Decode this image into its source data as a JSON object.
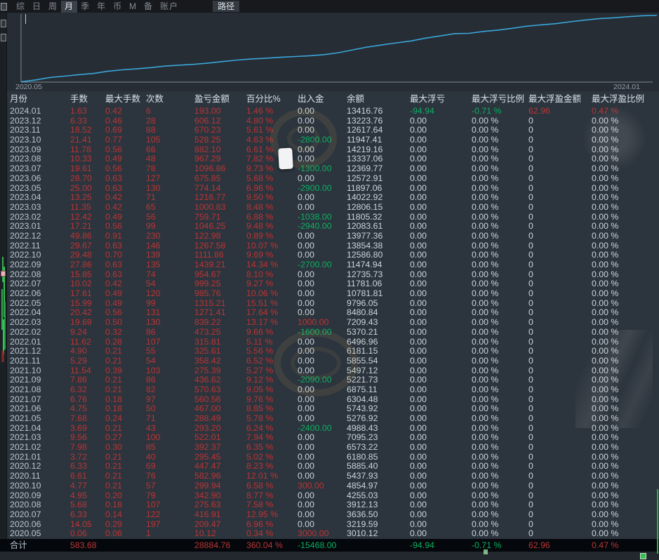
{
  "menu": {
    "items": [
      {
        "label": "综",
        "active": false
      },
      {
        "label": "日",
        "active": false
      },
      {
        "label": "周",
        "active": false
      },
      {
        "label": "月",
        "active": true
      },
      {
        "label": "季",
        "active": false
      },
      {
        "label": "年",
        "active": false
      },
      {
        "label": "币",
        "active": false
      },
      {
        "label": "M",
        "active": false
      },
      {
        "label": "备",
        "active": false
      },
      {
        "label": "账户",
        "active": false
      }
    ],
    "path_label": "路径"
  },
  "chart": {
    "x_start_label": "2020.05",
    "x_end_label": "2024.01"
  },
  "chart_data": {
    "type": "line",
    "x": [
      "2020.05",
      "2020.06",
      "2020.07",
      "2020.08",
      "2020.09",
      "2020.10",
      "2020.11",
      "2020.12",
      "2021.01",
      "2021.02",
      "2021.03",
      "2021.04",
      "2021.05",
      "2021.06",
      "2021.07",
      "2021.08",
      "2021.09",
      "2021.10",
      "2021.11",
      "2021.12",
      "2022.01",
      "2022.02",
      "2022.03",
      "2022.04",
      "2022.05",
      "2022.06",
      "2022.07",
      "2022.08",
      "2022.09",
      "2022.10",
      "2022.11",
      "2022.12",
      "2023.01",
      "2023.02",
      "2023.03",
      "2023.04",
      "2023.05",
      "2023.06",
      "2023.07",
      "2023.08",
      "2023.09",
      "2023.10",
      "2023.11",
      "2023.12",
      "2024.01"
    ],
    "series": [
      {
        "name": "cumulative-profit",
        "values": [
          10.12,
          219.59,
          636.5,
          912.13,
          1255.03,
          1554.97,
          2137.93,
          2585.4,
          2880.85,
          3273.22,
          3795.23,
          4088.43,
          4376.92,
          4843.92,
          5404.48,
          5975.11,
          6411.73,
          6687.12,
          7045.54,
          7371.15,
          7686.96,
          8160.21,
          8999.43,
          10270.84,
          11586.05,
          12571.81,
          13571.06,
          14525.73,
          15964.94,
          17076.8,
          18344.38,
          18467.36,
          19513.61,
          20273.32,
          21274.15,
          22490.92,
          23265.06,
          23940.91,
          25037.77,
          26005.06,
          26887.16,
          27415.41,
          28085.64,
          28691.76,
          28884.76
        ]
      }
    ],
    "monthly_profit": [
      10.12,
      209.47,
      416.91,
      275.63,
      342.9,
      299.94,
      582.96,
      447.47,
      295.45,
      392.37,
      522.01,
      293.2,
      288.49,
      467.0,
      560.56,
      570.63,
      436.62,
      275.39,
      358.42,
      325.61,
      315.81,
      473.25,
      839.22,
      1271.41,
      1315.21,
      985.76,
      999.25,
      954.67,
      1439.21,
      1111.86,
      1267.58,
      122.98,
      1046.25,
      759.71,
      1000.83,
      1216.77,
      774.14,
      675.85,
      1096.86,
      967.29,
      882.1,
      528.25,
      670.23,
      606.12,
      193.0
    ],
    "title": "",
    "xlabel": "",
    "ylabel": "",
    "ylim": [
      0,
      28884.76
    ],
    "x_tick_labels": [
      "2020.05",
      "2024.01"
    ],
    "grid": false,
    "legend": false,
    "line_color": "#3aa6d9"
  },
  "table": {
    "columns": [
      "月份",
      "手数",
      "最大手数",
      "次数",
      "盈亏金额",
      "百分比%",
      "出入金",
      "余额",
      "最大浮亏",
      "最大浮亏比例",
      "最大浮盈金额",
      "最大浮盈比例"
    ],
    "rows": [
      [
        "2024.01",
        "1.63",
        "0.42",
        "6",
        "193.00",
        "1.46 %",
        "0.00",
        "13416.76",
        "-94.94",
        "-0.71 %",
        "62.96",
        "0.47 %"
      ],
      [
        "2023.12",
        "6.33",
        "0.46",
        "28",
        "606.12",
        "4.80 %",
        "0.00",
        "13223.76",
        "0.00",
        "0.00 %",
        "0",
        "0.00 %"
      ],
      [
        "2023.11",
        "18.52",
        "0.69",
        "88",
        "670.23",
        "5.61 %",
        "0.00",
        "12617.64",
        "0.00",
        "0.00 %",
        "0",
        "0.00 %"
      ],
      [
        "2023.10",
        "21.41",
        "0.77",
        "105",
        "528.25",
        "4.63 %",
        "-2800.00",
        "11947.41",
        "0.00",
        "0.00 %",
        "0",
        "0.00 %"
      ],
      [
        "2023.09",
        "11.78",
        "0.56",
        "66",
        "882.10",
        "6.61 %",
        "0.00",
        "14219.16",
        "0.00",
        "0.00 %",
        "0",
        "0.00 %"
      ],
      [
        "2023.08",
        "10.33",
        "0.49",
        "48",
        "967.29",
        "7.82 %",
        "0.00",
        "13337.06",
        "0.00",
        "0.00 %",
        "0",
        "0.00 %"
      ],
      [
        "2023.07",
        "19.61",
        "0.56",
        "78",
        "1096.86",
        "9.73 %",
        "-1300.00",
        "12369.77",
        "0.00",
        "0.00 %",
        "0",
        "0.00 %"
      ],
      [
        "2023.06",
        "28.70",
        "0.63",
        "127",
        "675.85",
        "5.68 %",
        "0.00",
        "12572.91",
        "0.00",
        "0.00 %",
        "0",
        "0.00 %"
      ],
      [
        "2023.05",
        "25.00",
        "0.63",
        "130",
        "774.14",
        "6.96 %",
        "-2900.00",
        "11897.06",
        "0.00",
        "0.00 %",
        "0",
        "0.00 %"
      ],
      [
        "2023.04",
        "13.25",
        "0.42",
        "71",
        "1216.77",
        "9.50 %",
        "0.00",
        "14022.92",
        "0.00",
        "0.00 %",
        "0",
        "0.00 %"
      ],
      [
        "2023.03",
        "11.35",
        "0.42",
        "65",
        "1000.83",
        "8.48 %",
        "0.00",
        "12806.15",
        "0.00",
        "0.00 %",
        "0",
        "0.00 %"
      ],
      [
        "2023.02",
        "12.42",
        "0.49",
        "56",
        "759.71",
        "6.88 %",
        "-1038.00",
        "11805.32",
        "0.00",
        "0.00 %",
        "0",
        "0.00 %"
      ],
      [
        "2023.01",
        "17.21",
        "0.56",
        "99",
        "1046.25",
        "9.48 %",
        "-2940.00",
        "12083.61",
        "0.00",
        "0.00 %",
        "0",
        "0.00 %"
      ],
      [
        "2022.12",
        "49.86",
        "0.91",
        "230",
        "122.98",
        "0.89 %",
        "0.00",
        "13977.36",
        "0.00",
        "0.00 %",
        "0",
        "0.00 %"
      ],
      [
        "2022.11",
        "29.67",
        "0.63",
        "146",
        "1267.58",
        "10.07 %",
        "0.00",
        "13854.38",
        "0.00",
        "0.00 %",
        "0",
        "0.00 %"
      ],
      [
        "2022.10",
        "29.48",
        "0.70",
        "139",
        "1111.86",
        "9.69 %",
        "0.00",
        "12586.80",
        "0.00",
        "0.00 %",
        "0",
        "0.00 %"
      ],
      [
        "2022.09",
        "27.86",
        "0.63",
        "135",
        "1439.21",
        "14.34 %",
        "-2700.00",
        "11474.94",
        "0.00",
        "0.00 %",
        "0",
        "0.00 %"
      ],
      [
        "2022.08",
        "15.85",
        "0.63",
        "74",
        "954.67",
        "8.10 %",
        "0.00",
        "12735.73",
        "0.00",
        "0.00 %",
        "0",
        "0.00 %"
      ],
      [
        "2022.07",
        "10.02",
        "0.42",
        "54",
        "999.25",
        "9.27 %",
        "0.00",
        "11781.06",
        "0.00",
        "0.00 %",
        "0",
        "0.00 %"
      ],
      [
        "2022.06",
        "17.61",
        "0.49",
        "120",
        "985.76",
        "10.06 %",
        "0.00",
        "10781.81",
        "0.00",
        "0.00 %",
        "0",
        "0.00 %"
      ],
      [
        "2022.05",
        "15.99",
        "0.49",
        "99",
        "1315.21",
        "15.51 %",
        "0.00",
        "9796.05",
        "0.00",
        "0.00 %",
        "0",
        "0.00 %"
      ],
      [
        "2022.04",
        "20.42",
        "0.56",
        "131",
        "1271.41",
        "17.64 %",
        "0.00",
        "8480.84",
        "0.00",
        "0.00 %",
        "0",
        "0.00 %"
      ],
      [
        "2022.03",
        "19.69",
        "0.50",
        "130",
        "839.22",
        "13.17 %",
        "1000.00",
        "7209.43",
        "0.00",
        "0.00 %",
        "0",
        "0.00 %"
      ],
      [
        "2022.02",
        "9.24",
        "0.32",
        "86",
        "473.25",
        "9.66 %",
        "-1600.00",
        "5370.21",
        "0.00",
        "0.00 %",
        "0",
        "0.00 %"
      ],
      [
        "2022.01",
        "11.62",
        "0.28",
        "107",
        "315.81",
        "5.11 %",
        "0.00",
        "6496.96",
        "0.00",
        "0.00 %",
        "0",
        "0.00 %"
      ],
      [
        "2021.12",
        "4.90",
        "0.21",
        "55",
        "325.61",
        "5.56 %",
        "0.00",
        "6181.15",
        "0.00",
        "0.00 %",
        "0",
        "0.00 %"
      ],
      [
        "2021.11",
        "5.29",
        "0.21",
        "54",
        "358.42",
        "6.52 %",
        "0.00",
        "5855.54",
        "0.00",
        "0.00 %",
        "0",
        "0.00 %"
      ],
      [
        "2021.10",
        "11.54",
        "0.39",
        "103",
        "275.39",
        "5.27 %",
        "0.00",
        "5497.12",
        "0.00",
        "0.00 %",
        "0",
        "0.00 %"
      ],
      [
        "2021.09",
        "7.86",
        "0.21",
        "86",
        "436.62",
        "9.12 %",
        "-2090.00",
        "5221.73",
        "0.00",
        "0.00 %",
        "0",
        "0.00 %"
      ],
      [
        "2021.08",
        "6.32",
        "0.21",
        "82",
        "570.63",
        "9.05 %",
        "0.00",
        "6875.11",
        "0.00",
        "0.00 %",
        "0",
        "0.00 %"
      ],
      [
        "2021.07",
        "6.76",
        "0.18",
        "97",
        "560.56",
        "9.76 %",
        "0.00",
        "6304.48",
        "0.00",
        "0.00 %",
        "0",
        "0.00 %"
      ],
      [
        "2021.06",
        "4.75",
        "0.18",
        "50",
        "467.00",
        "8.85 %",
        "0.00",
        "5743.92",
        "0.00",
        "0.00 %",
        "0",
        "0.00 %"
      ],
      [
        "2021.05",
        "7.68",
        "0.24",
        "71",
        "288.49",
        "5.78 %",
        "0.00",
        "5276.92",
        "0.00",
        "0.00 %",
        "0",
        "0.00 %"
      ],
      [
        "2021.04",
        "3.69",
        "0.21",
        "43",
        "293.20",
        "6.24 %",
        "-2400.00",
        "4988.43",
        "0.00",
        "0.00 %",
        "0",
        "0.00 %"
      ],
      [
        "2021.03",
        "9.56",
        "0.27",
        "100",
        "522.01",
        "7.94 %",
        "0.00",
        "7095.23",
        "0.00",
        "0.00 %",
        "0",
        "0.00 %"
      ],
      [
        "2021.02",
        "7.98",
        "0.30",
        "85",
        "392.37",
        "6.35 %",
        "0.00",
        "6573.22",
        "0.00",
        "0.00 %",
        "0",
        "0.00 %"
      ],
      [
        "2021.01",
        "3.72",
        "0.21",
        "40",
        "295.45",
        "5.02 %",
        "0.00",
        "6180.85",
        "0.00",
        "0.00 %",
        "0",
        "0.00 %"
      ],
      [
        "2020.12",
        "6.33",
        "0.21",
        "69",
        "447.47",
        "8.23 %",
        "0.00",
        "5885.40",
        "0.00",
        "0.00 %",
        "0",
        "0.00 %"
      ],
      [
        "2020.11",
        "6.61",
        "0.21",
        "76",
        "582.96",
        "12.01 %",
        "0.00",
        "5437.93",
        "0.00",
        "0.00 %",
        "0",
        "0.00 %"
      ],
      [
        "2020.10",
        "4.77",
        "0.21",
        "57",
        "299.94",
        "6.58 %",
        "300.00",
        "4854.97",
        "0.00",
        "0.00 %",
        "0",
        "0.00 %"
      ],
      [
        "2020.09",
        "4.95",
        "0.20",
        "79",
        "342.90",
        "8.77 %",
        "0.00",
        "4255.03",
        "0.00",
        "0.00 %",
        "0",
        "0.00 %"
      ],
      [
        "2020.08",
        "5.68",
        "0.18",
        "107",
        "275.63",
        "7.58 %",
        "0.00",
        "3912.13",
        "0.00",
        "0.00 %",
        "0",
        "0.00 %"
      ],
      [
        "2020.07",
        "6.33",
        "0.14",
        "122",
        "416.91",
        "12.95 %",
        "0.00",
        "3636.50",
        "0.00",
        "0.00 %",
        "0",
        "0.00 %"
      ],
      [
        "2020.06",
        "14.05",
        "0.29",
        "197",
        "209.47",
        "6.96 %",
        "0.00",
        "3219.59",
        "0.00",
        "0.00 %",
        "0",
        "0.00 %"
      ],
      [
        "2020.05",
        "0.06",
        "0.06",
        "1",
        "10.12",
        "0.34 %",
        "3000.00",
        "3010.12",
        "0.00",
        "0.00 %",
        "0",
        "0.00 %"
      ]
    ],
    "total": [
      "合计",
      "583.68",
      "",
      "",
      "28884.76",
      "360.04 %",
      "-15468.00",
      "",
      "-94.94",
      "-0.71 %",
      "62.96",
      "0.47 %"
    ]
  },
  "colors": {
    "bg": "#2c343d",
    "chart_bg": "#262d35",
    "menu_bg": "#17191d",
    "accent_line": "#3aa6d9",
    "red": "#bb3535",
    "green": "#0ab162",
    "white_val": "#cdd6dd",
    "month": "#bac7d3",
    "header": "#d8e1e9",
    "total_bg": "#04070b"
  }
}
